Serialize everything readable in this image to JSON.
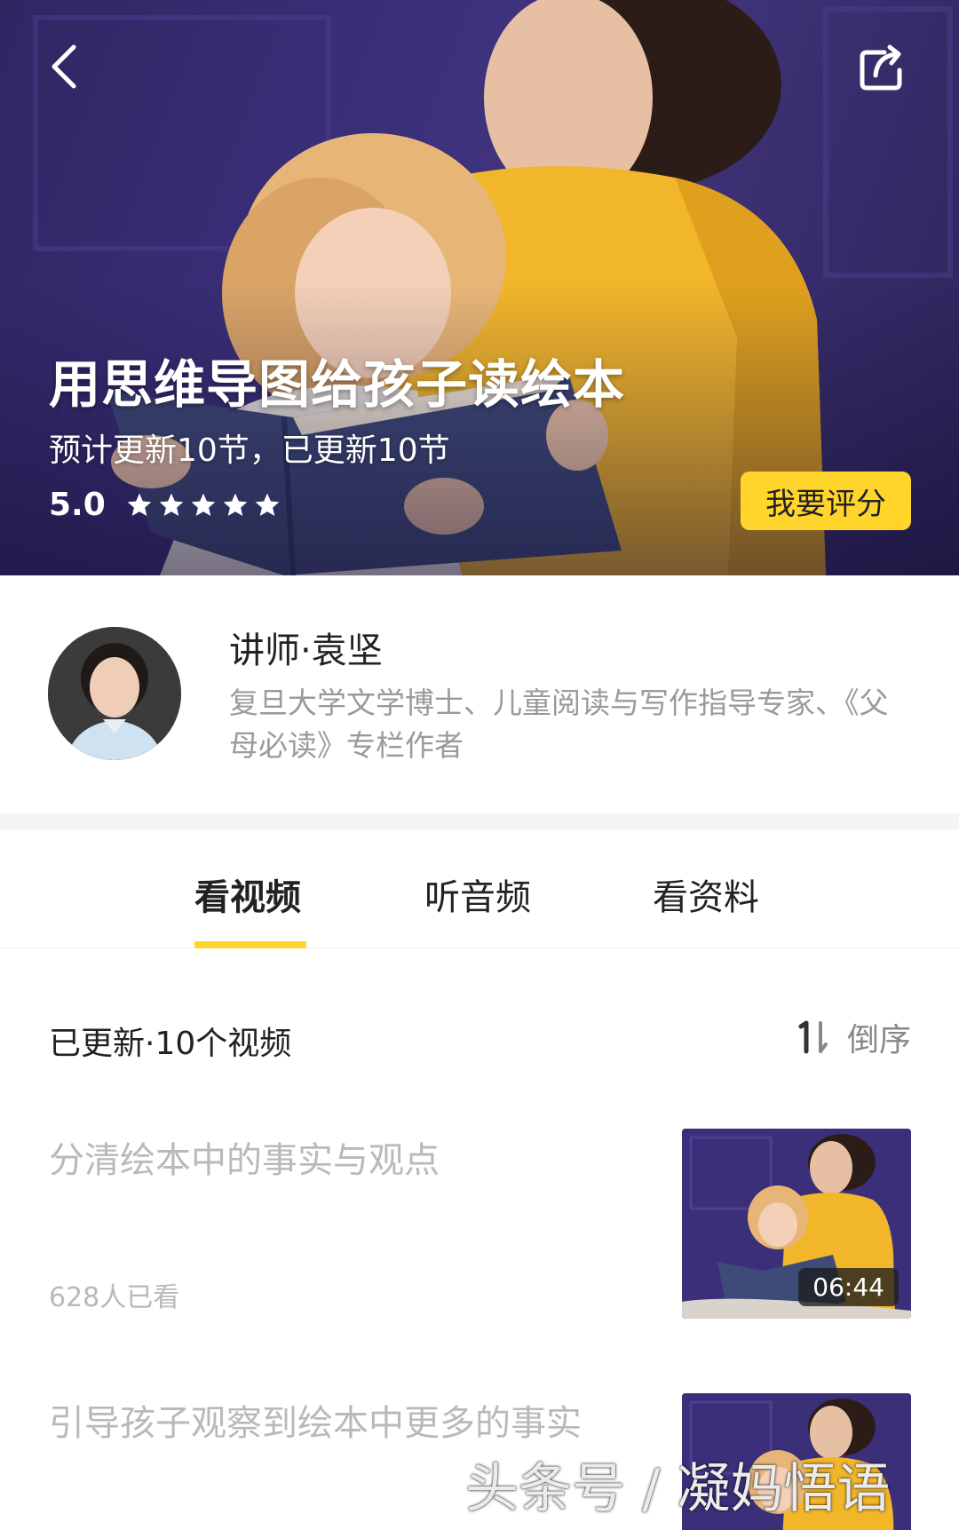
{
  "header": {
    "back_icon": "chevron-left-icon",
    "share_icon": "share-icon"
  },
  "course": {
    "title": "用思维导图给孩子读绘本",
    "update_status": "预计更新10节，已更新10节",
    "score": "5.0",
    "stars": 5,
    "rate_button": "我要评分",
    "accent_color": "#ffd52b"
  },
  "lecturer": {
    "name": "讲师·袁坚",
    "description": "复旦大学文学博士、儿童阅读与写作指导专家、《父母必读》专栏作者"
  },
  "tabs": [
    {
      "label": "看视频",
      "active": true
    },
    {
      "label": "听音频",
      "active": false
    },
    {
      "label": "看资料",
      "active": false
    }
  ],
  "list": {
    "count_label": "已更新·10个视频",
    "sort_label": "倒序",
    "sort_icon": "sort-order-icon",
    "items": [
      {
        "title": "分清绘本中的事实与观点",
        "views": "628人已看",
        "duration": "06:44"
      },
      {
        "title": "引导孩子观察到绘本中更多的事实",
        "views": "",
        "duration": ""
      }
    ]
  },
  "watermark": "头条号 / 凝妈悟语"
}
